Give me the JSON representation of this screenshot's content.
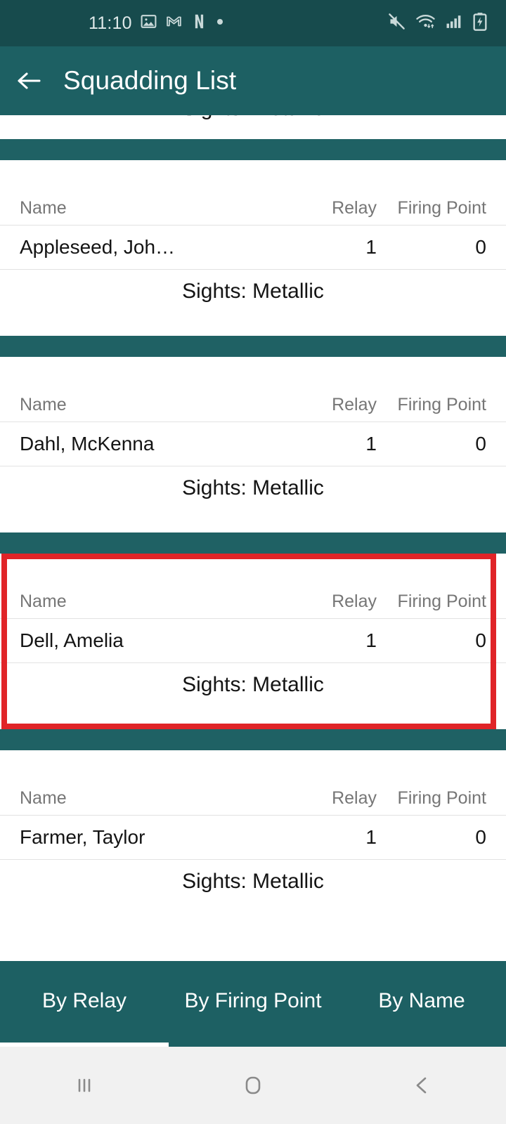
{
  "status_bar": {
    "time": "11:10",
    "left_icons": [
      "photos-icon",
      "gmail-icon",
      "netflix-icon",
      "dot-icon"
    ],
    "right_icons": [
      "mute-icon",
      "wifi-icon",
      "cellular-signal-icon",
      "battery-charging-icon"
    ],
    "background": "#174b4d"
  },
  "app_bar": {
    "back_icon": "back-arrow-icon",
    "title": "Squadding List",
    "background": "#1d6063"
  },
  "list": {
    "columns": [
      "Name",
      "Relay",
      "Firing Point"
    ],
    "sights_prefix": "Sights: ",
    "cards": [
      {
        "name": "Appleseed, Joh…",
        "relay": "1",
        "firing_point": "0",
        "sights": "Sights: Metallic",
        "highlighted": false
      },
      {
        "name": "Dahl, McKenna",
        "relay": "1",
        "firing_point": "0",
        "sights": "Sights: Metallic",
        "highlighted": false
      },
      {
        "name": "Dell, Amelia",
        "relay": "1",
        "firing_point": "0",
        "sights": "Sights: Metallic",
        "highlighted": true
      },
      {
        "name": "Farmer, Taylor",
        "relay": "1",
        "firing_point": "0",
        "sights": "Sights: Metallic",
        "highlighted": false
      }
    ],
    "partial_top_text": "Sights: Metallic",
    "divider_color": "#1f6164",
    "highlight_color": "#e02428"
  },
  "tabs": {
    "items": [
      {
        "label": "By Relay",
        "active": true
      },
      {
        "label": "By Firing Point",
        "active": false
      },
      {
        "label": "By Name",
        "active": false
      }
    ],
    "background": "#1d6063",
    "indicator_color": "#ffffff"
  },
  "nav_bar": {
    "buttons": [
      "recents-icon",
      "home-icon",
      "back-icon"
    ],
    "background": "#f1f1f1"
  }
}
